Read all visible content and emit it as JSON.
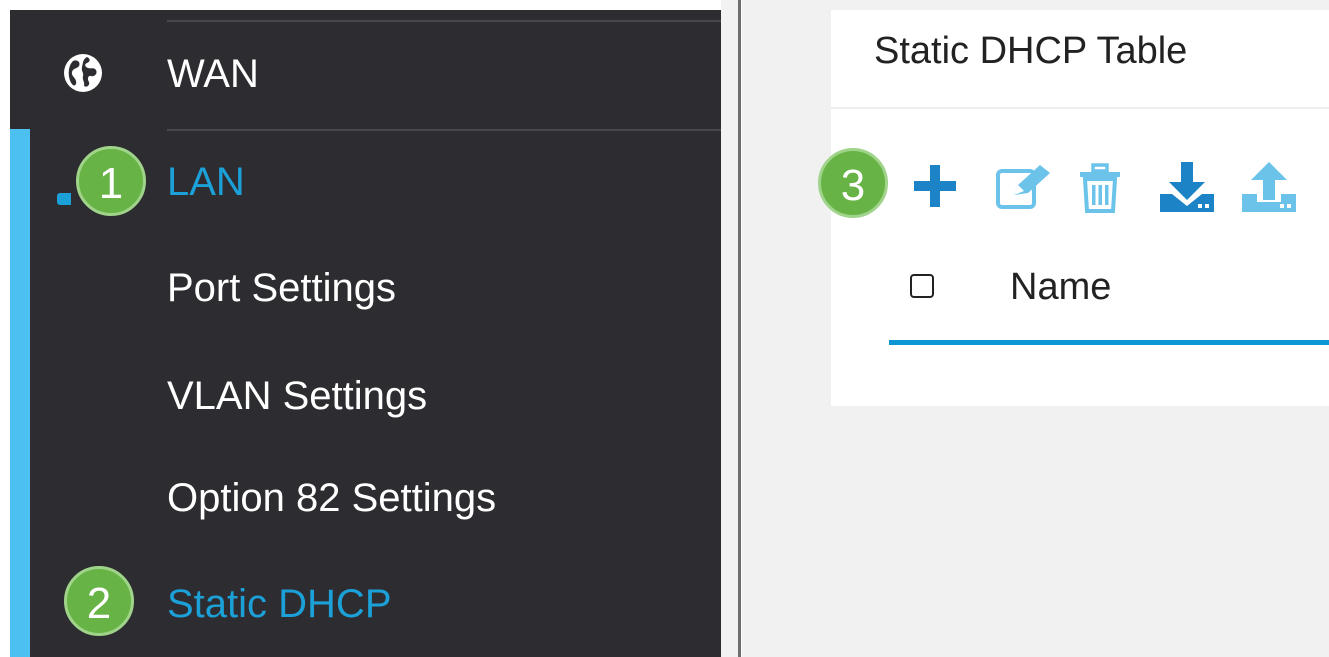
{
  "sidebar": {
    "items": [
      {
        "label": "WAN",
        "icon": "globe-icon",
        "active": false
      },
      {
        "label": "LAN",
        "icon": "lan-icon",
        "active": true
      },
      {
        "label": "Port Settings",
        "active": false
      },
      {
        "label": "VLAN Settings",
        "active": false
      },
      {
        "label": "Option 82 Settings",
        "active": false
      },
      {
        "label": "Static DHCP",
        "active": true
      }
    ]
  },
  "callouts": {
    "one": "1",
    "two": "2",
    "three": "3"
  },
  "panel": {
    "title": "Static DHCP Table",
    "toolbar": [
      "add-icon",
      "edit-icon",
      "delete-icon",
      "import-icon",
      "export-icon"
    ],
    "table": {
      "columns": [
        "Name"
      ]
    }
  },
  "colors": {
    "sidebar_bg": "#2d2c30",
    "accent": "#1ba0d8",
    "sidebar_accent": "#4cc0f0",
    "callout": "#67b346",
    "header_underline": "#0b96d6"
  }
}
